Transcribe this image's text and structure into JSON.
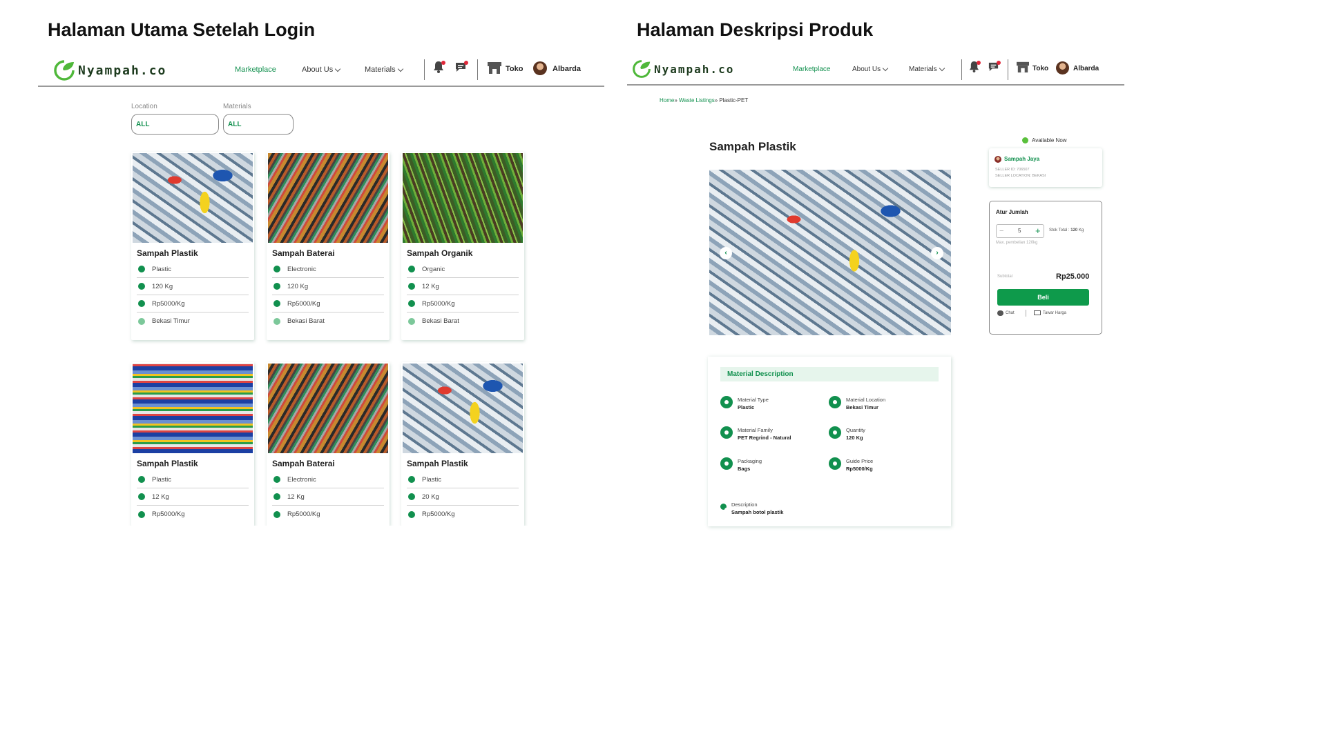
{
  "left_section": {
    "title": "Halaman Utama Setelah Login",
    "navbar": {
      "logo": "Nyampah.co",
      "links": [
        {
          "label": "Marketplace",
          "active": true
        },
        {
          "label": "About Us",
          "dropdown": true
        },
        {
          "label": "Materials",
          "dropdown": true
        }
      ],
      "store_label": "Toko",
      "user_name": "Albarda"
    },
    "filters": {
      "location_label": "Location",
      "location_value": "ALL",
      "materials_label": "Materials",
      "materials_value": "ALL"
    },
    "cards": [
      {
        "title": "Sampah Plastik",
        "category": "Plastic",
        "quantity": "120 Kg",
        "price": "Rp5000/Kg",
        "location": "Bekasi Timur",
        "image": "plastic-bottles"
      },
      {
        "title": "Sampah Baterai",
        "category": "Electronic",
        "quantity": "120 Kg",
        "price": "Rp5000/Kg",
        "location": "Bekasi Barat",
        "image": "batteries"
      },
      {
        "title": "Sampah Organik",
        "category": "Organic",
        "quantity": "12 Kg",
        "price": "Rp5000/Kg",
        "location": "Bekasi Barat",
        "image": "organic-plants"
      },
      {
        "title": "Sampah Plastik",
        "category": "Plastic",
        "quantity": "12 Kg",
        "price": "Rp5000/Kg",
        "image": "plastic-bales"
      },
      {
        "title": "Sampah Baterai",
        "category": "Electronic",
        "quantity": "12 Kg",
        "price": "Rp5000/Kg",
        "image": "batteries"
      },
      {
        "title": "Sampah Plastik",
        "category": "Plastic",
        "quantity": "20 Kg",
        "price": "Rp5000/Kg",
        "image": "plastic-bottles"
      }
    ]
  },
  "right_section": {
    "title": "Halaman Deskripsi Produk",
    "navbar": {
      "logo": "Nyampah.co",
      "links": [
        {
          "label": "Marketplace",
          "active": true
        },
        {
          "label": "About Us",
          "dropdown": true
        },
        {
          "label": "Materials",
          "dropdown": true
        }
      ],
      "store_label": "Toko",
      "user_name": "Albarda"
    },
    "breadcrumb": {
      "home": "Home",
      "listings": "Waste Listings",
      "current": "Plastic-PET"
    },
    "product_title": "Sampah Plastik",
    "availability": "Available Now",
    "seller": {
      "name": "Sampah Jaya",
      "id_line": "SELLER ID: 706507",
      "location_line": "SELLER LOCATION: BEKASI"
    },
    "purchase": {
      "heading": "Atur Jumlah",
      "quantity": "5",
      "stock_label": "Stok Total :",
      "stock_value": "120",
      "stock_unit": "Kg",
      "max_note": "Max. pembelian 120kg",
      "subtotal_label": "Subtotal",
      "subtotal_value": "Rp25.000",
      "buy_label": "Beli",
      "chat_label": "Chat",
      "offer_label": "Tawar Harga"
    },
    "material_description": {
      "heading": "Material Description",
      "attributes": [
        {
          "label": "Material Type",
          "value": "Plastic",
          "icon": "recycle-icon"
        },
        {
          "label": "Material Location",
          "value": "Bekasi Timur",
          "icon": "location-pin-icon"
        },
        {
          "label": "Material Family",
          "value": "PET Regrind - Natural",
          "icon": "family-icon"
        },
        {
          "label": "Quantity",
          "value": "120 Kg",
          "icon": "weight-icon"
        },
        {
          "label": "Packaging",
          "value": "Bags",
          "icon": "packaging-icon"
        },
        {
          "label": "Guide Price",
          "value": "Rp5000/Kg",
          "icon": "price-tag-icon"
        }
      ],
      "description_label": "Description",
      "description_value": "Sampah botol plastik"
    }
  },
  "colors": {
    "accent": "#11904e",
    "badge": "#e0283a",
    "available": "#5ac03c",
    "header_bg": "#e6f5ec"
  }
}
